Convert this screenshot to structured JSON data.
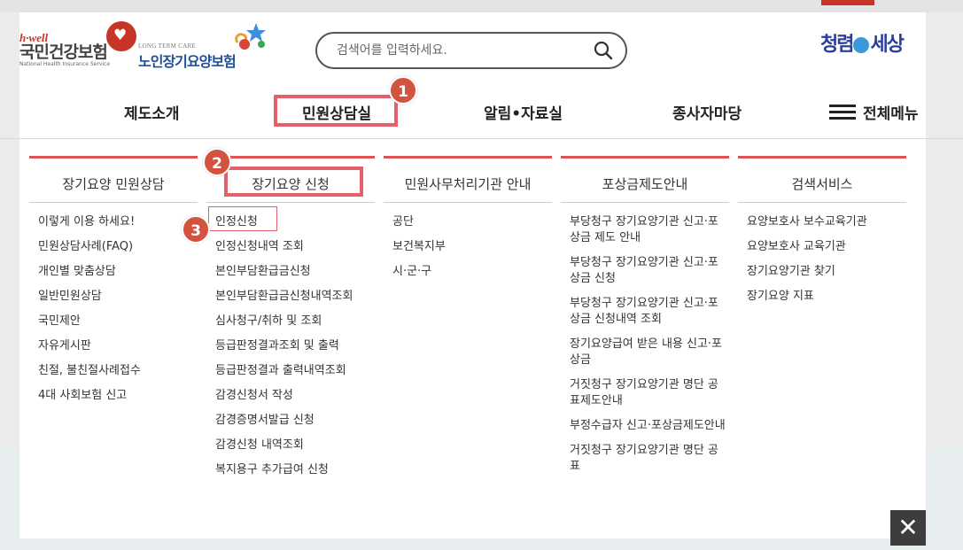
{
  "branding": {
    "nhis_hwell": "h·well",
    "nhis_name": "국민건강보험",
    "nhis_english": "National Health Insurance Service",
    "ltc_english": "LONG TERM CARE",
    "ltc_name": "노인장기요양보험",
    "clean_logo_left": "청렴",
    "clean_logo_right": "세상"
  },
  "search": {
    "placeholder": "검색어를 입력하세요."
  },
  "gnb": {
    "items": [
      "제도소개",
      "민원상담실",
      "알림•자료실",
      "종사자마당"
    ],
    "all_menu": "전체메뉴"
  },
  "annotations": [
    "1",
    "2",
    "3"
  ],
  "columns": [
    {
      "title": "장기요양 민원상담",
      "items": [
        "이렇게 이용 하세요!",
        "민원상담사례(FAQ)",
        "개인별 맞춤상담",
        "일반민원상담",
        "국민제안",
        "자유게시판",
        "친절, 불친절사례접수",
        "4대 사회보험 신고"
      ]
    },
    {
      "title": "장기요양 신청",
      "items": [
        "인정신청",
        "인정신청내역 조회",
        "본인부담환급금신청",
        "본인부담환급금신청내역조회",
        "심사청구/취하 및 조회",
        "등급판정결과조회 및 출력",
        "등급판정결과 출력내역조회",
        "감경신청서 작성",
        "감경증명서발급 신청",
        "감경신청 내역조회",
        "복지용구 추가급여 신청"
      ]
    },
    {
      "title": "민원사무처리기관 안내",
      "items": [
        "공단",
        "보건복지부",
        "시·군·구"
      ]
    },
    {
      "title": "포상금제도안내",
      "items": [
        "부당청구 장기요양기관 신고·포상금 제도 안내",
        "부당청구 장기요양기관 신고·포상금 신청",
        "부당청구 장기요양기관 신고·포상금 신청내역 조회",
        "장기요양급여 받은 내용 신고·포상금",
        "거짓청구 장기요양기관 명단 공표제도안내",
        "부정수급자 신고·포상금제도안내",
        "거짓청구 장기요양기관 명단 공표"
      ]
    },
    {
      "title": "검색서비스",
      "items": [
        "요양보호사 보수교육기관",
        "요양보호사 교육기관",
        "장기요양기관 찾기",
        "장기요양 지표"
      ]
    }
  ],
  "close_label": "✕",
  "colors": {
    "accent_red": "#e05353",
    "highlight": "#e5606a",
    "badge": "#d4533f",
    "brand_blue": "#1d4f9c"
  }
}
